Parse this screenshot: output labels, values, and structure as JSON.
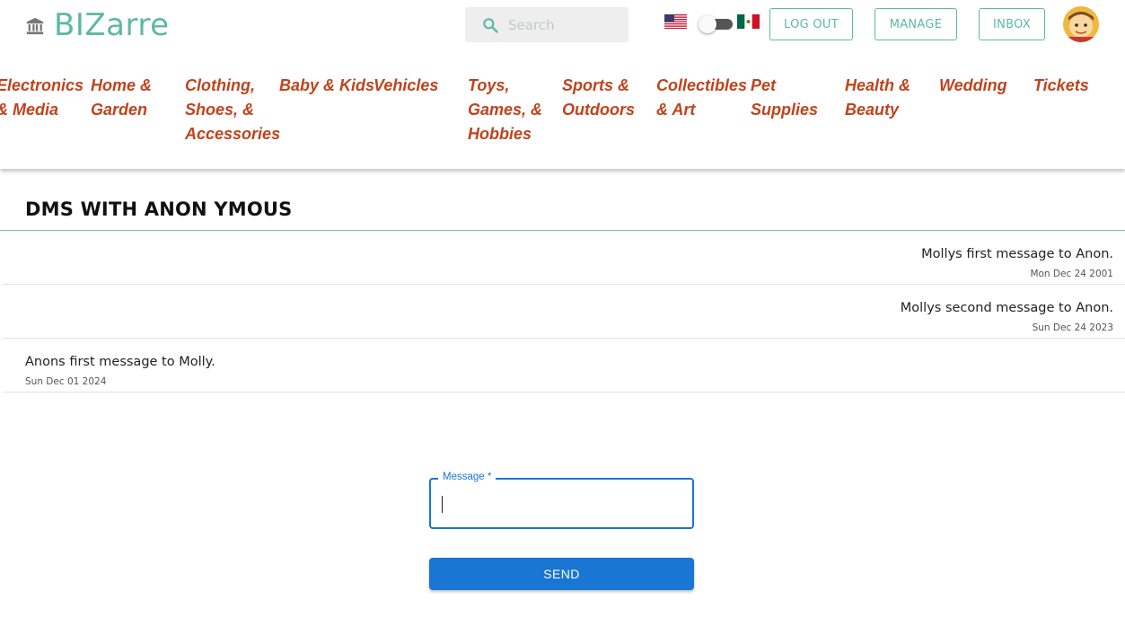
{
  "header": {
    "logo_text": "BIZarre",
    "logo_icon": "bank-icon",
    "search": {
      "placeholder": "Search",
      "icon": "search-icon"
    },
    "language": {
      "left_flag": "us-flag-icon",
      "right_flag": "mexico-flag-icon",
      "toggle_state": "off"
    },
    "buttons": {
      "logout": "LOG OUT",
      "manage": "MANAGE",
      "inbox": "INBOX"
    },
    "accent_color": "#5cb9a2"
  },
  "categories": [
    "Electronics & Media",
    "Home & Garden",
    "Clothing, Shoes, & Accessories",
    "Baby & Kids",
    "Vehicles",
    "Toys, Games, & Hobbies",
    "Sports & Outdoors",
    "Collectibles & Art",
    "Pet Supplies",
    "Health & Beauty",
    "Wedding",
    "Tickets"
  ],
  "category_color": "#c0431c",
  "conversation": {
    "title": "DMS WITH ANON YMOUS",
    "messages": [
      {
        "text": "Mollys first message to Anon.",
        "date": "Mon Dec 24 2001",
        "align": "right"
      },
      {
        "text": "Mollys second message to Anon.",
        "date": "Sun Dec 24 2023",
        "align": "right"
      },
      {
        "text": "Anons first message to Molly.",
        "date": "Sun Dec 01 2024",
        "align": "left"
      }
    ]
  },
  "compose": {
    "label": "Message *",
    "value": "",
    "send_label": "SEND",
    "accent_color": "#1976d2"
  }
}
